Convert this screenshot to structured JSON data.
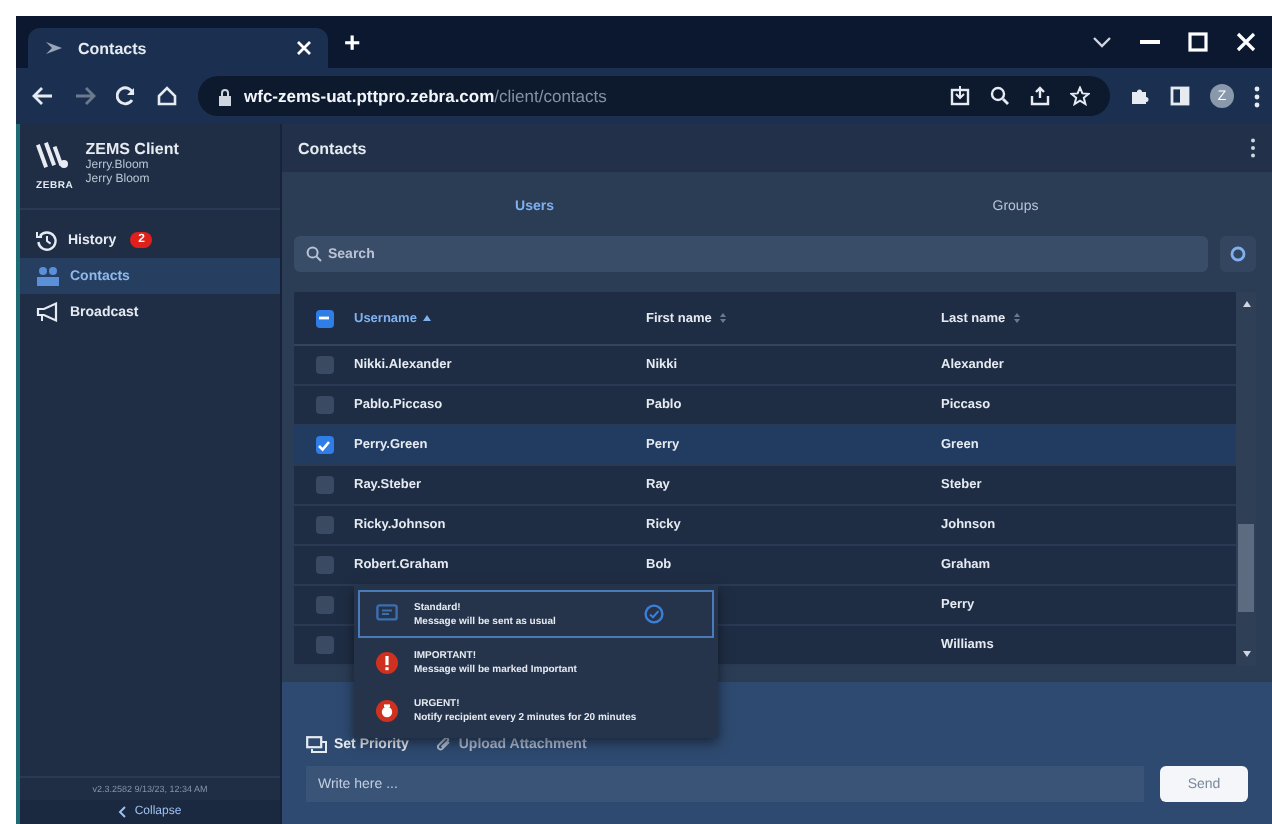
{
  "browser": {
    "tab_title": "Contacts",
    "new_tab": "+",
    "url_host": "wfc-zems-uat.pttpro.zebra.com",
    "url_path": "/client/contacts",
    "avatar": "Z"
  },
  "sidebar": {
    "app_name": "ZEMS Client",
    "user_login": "Jerry.Bloom",
    "user_name": "Jerry Bloom",
    "logo_text": "ZEBRA",
    "items": [
      {
        "label": "History",
        "badge": "2",
        "selected": false
      },
      {
        "label": "Contacts",
        "selected": true
      },
      {
        "label": "Broadcast",
        "selected": false
      }
    ],
    "version": "v2.3.2582 9/13/23, 12:34 AM",
    "collapse": "Collapse"
  },
  "header": {
    "title": "Contacts"
  },
  "tabs": [
    {
      "label": "Users",
      "selected": true
    },
    {
      "label": "Groups",
      "selected": false
    }
  ],
  "search": {
    "placeholder": "Search"
  },
  "table": {
    "header_checked": true,
    "columns": [
      {
        "label": "Username",
        "sorted": true
      },
      {
        "label": "First name",
        "sorted": false
      },
      {
        "label": "Last name",
        "sorted": false
      }
    ],
    "rows": [
      {
        "username": "Nikki.Alexander",
        "first_name": "Nikki",
        "last_name": "Alexander",
        "selected": false
      },
      {
        "username": "Pablo.Piccaso",
        "first_name": "Pablo",
        "last_name": "Piccaso",
        "selected": false
      },
      {
        "username": "Perry.Green",
        "first_name": "Perry",
        "last_name": "Green",
        "selected": true
      },
      {
        "username": "Ray.Steber",
        "first_name": "Ray",
        "last_name": "Steber",
        "selected": false
      },
      {
        "username": "Ricky.Johnson",
        "first_name": "Ricky",
        "last_name": "Johnson",
        "selected": false
      },
      {
        "username": "Robert.Graham",
        "first_name": "Bob",
        "last_name": "Graham",
        "selected": false
      },
      {
        "last_name": "Perry",
        "selected": false
      },
      {
        "last_name": "Williams",
        "selected": false
      }
    ]
  },
  "priority_menu": [
    {
      "kind": "standard",
      "title": "Standard!",
      "description": "Message will be sent as usual",
      "selected": true
    },
    {
      "kind": "important",
      "title": "IMPORTANT!",
      "description": "Message will be marked Important",
      "selected": false
    },
    {
      "kind": "urgent",
      "title": "URGENT!",
      "description": "Notify recipient every 2 minutes for 20 minutes",
      "selected": false
    }
  ],
  "compose": {
    "set_priority": "Set Priority",
    "upload": "Upload Attachment",
    "placeholder": "Write here ...",
    "send": "Send"
  }
}
